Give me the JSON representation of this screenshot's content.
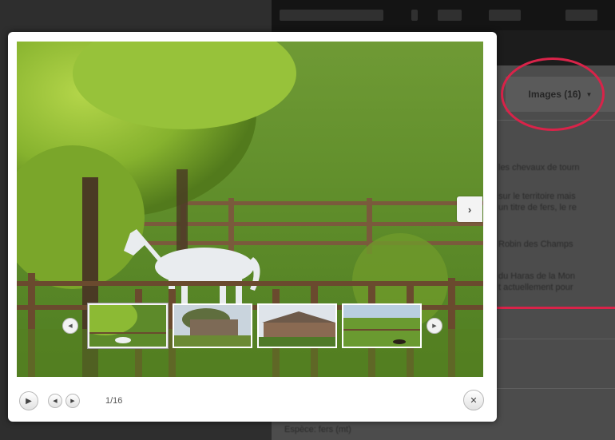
{
  "background_page": {
    "images_tab": {
      "label": "Images (16)",
      "caret": "▼"
    },
    "paragraphs": [
      "les chevaux de tourn",
      "sur le territoire mais",
      "un titre de fers, le re",
      "Robin des Champs",
      "du Haras de la Mon",
      "t actuellement pour"
    ],
    "bottom_text": "Espèce: fers (mt)"
  },
  "lightbox": {
    "next_arrow": "›",
    "thumbnails": {
      "prev_glyph": "◀",
      "next_glyph": "▶",
      "items": [
        {
          "name": "white-horse-pasture",
          "active": true
        },
        {
          "name": "stone-farmhouse"
        },
        {
          "name": "stable-building"
        },
        {
          "name": "green-field-horse"
        }
      ]
    },
    "controls": {
      "play_glyph": "▶",
      "prev_glyph": "◀",
      "next_glyph": "▶",
      "counter": "1/16",
      "close_glyph": "✕"
    }
  },
  "colors": {
    "annotation": "#d92349",
    "overlay": "#2e2e2e"
  }
}
